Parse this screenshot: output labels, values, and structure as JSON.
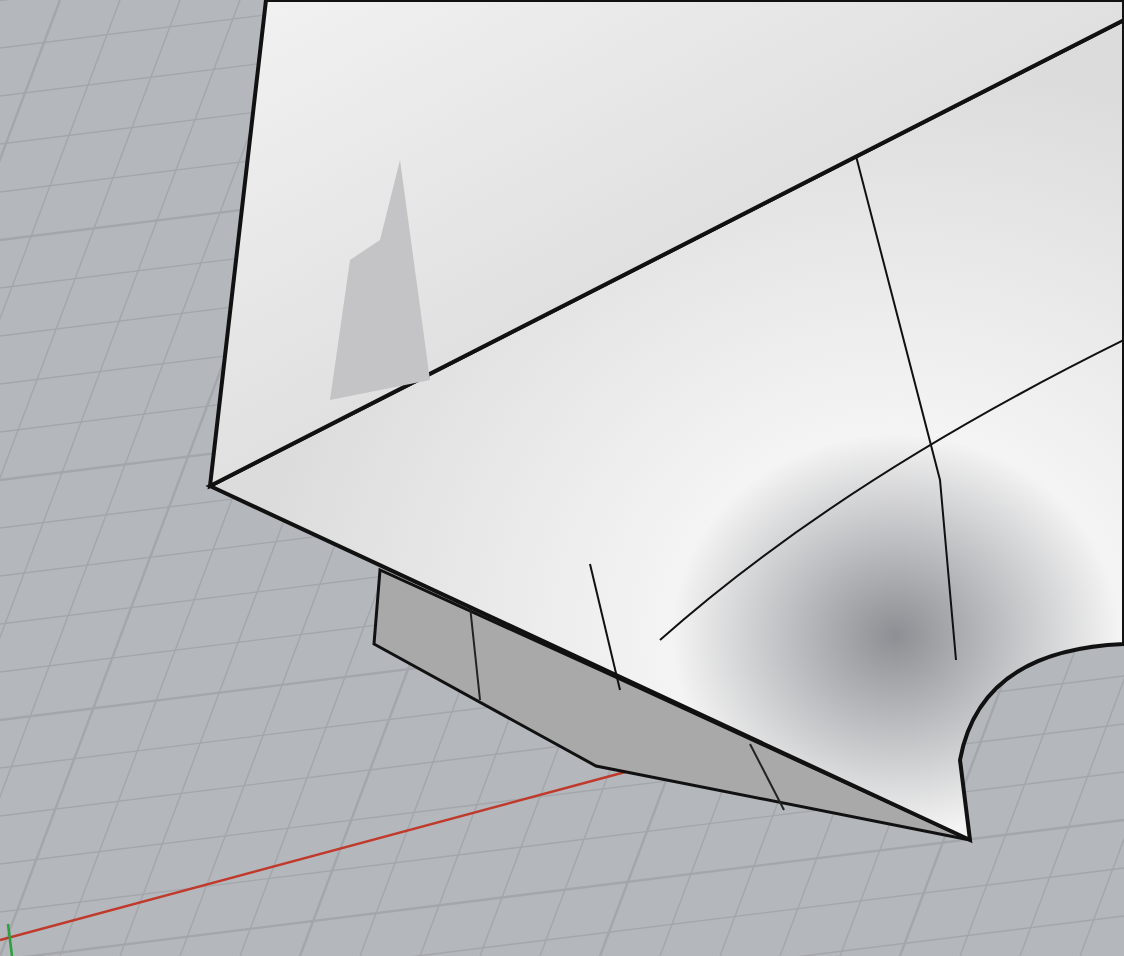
{
  "viewport": {
    "grid": true,
    "axes": true,
    "model_shown": true
  }
}
